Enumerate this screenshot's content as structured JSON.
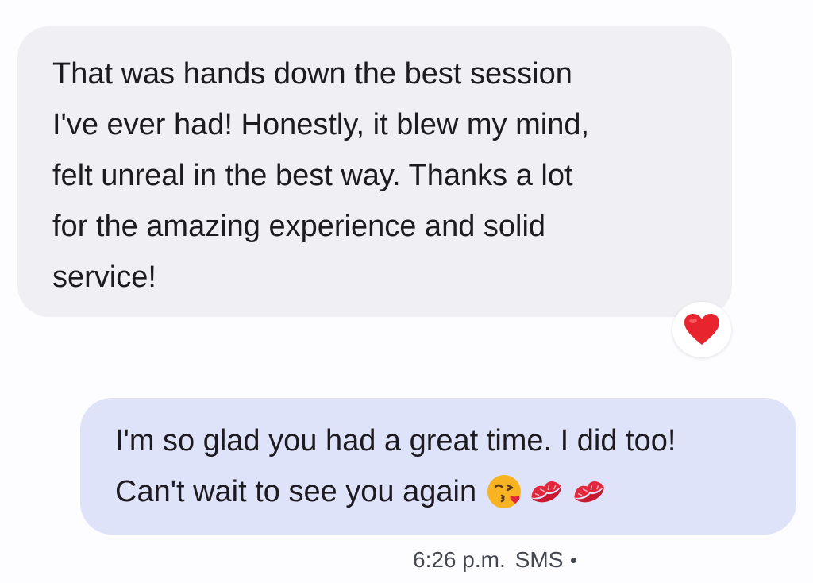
{
  "conversation": {
    "incoming": {
      "text": "That was hands down the best session\nI've ever had! Honestly, it blew my mind,\nfelt unreal in the best way. Thanks a lot\nfor the amazing experience and solid\nservice!",
      "reaction_icon": "red-heart-icon"
    },
    "outgoing": {
      "line1": "I'm so glad you had a great time. I did too!",
      "line2": "Can't wait to see you again",
      "emojis": [
        "face-blowing-kiss-icon",
        "kiss-mark-icon",
        "kiss-mark-icon"
      ],
      "time": "6:26 p.m.",
      "channel": "SMS"
    }
  },
  "colors": {
    "incoming_bubble": "#efeff4",
    "outgoing_bubble": "#dfe3fa",
    "heart": "#e8252f",
    "kiss_mark": "#e2263c",
    "kiss_face": "#f8b322"
  }
}
